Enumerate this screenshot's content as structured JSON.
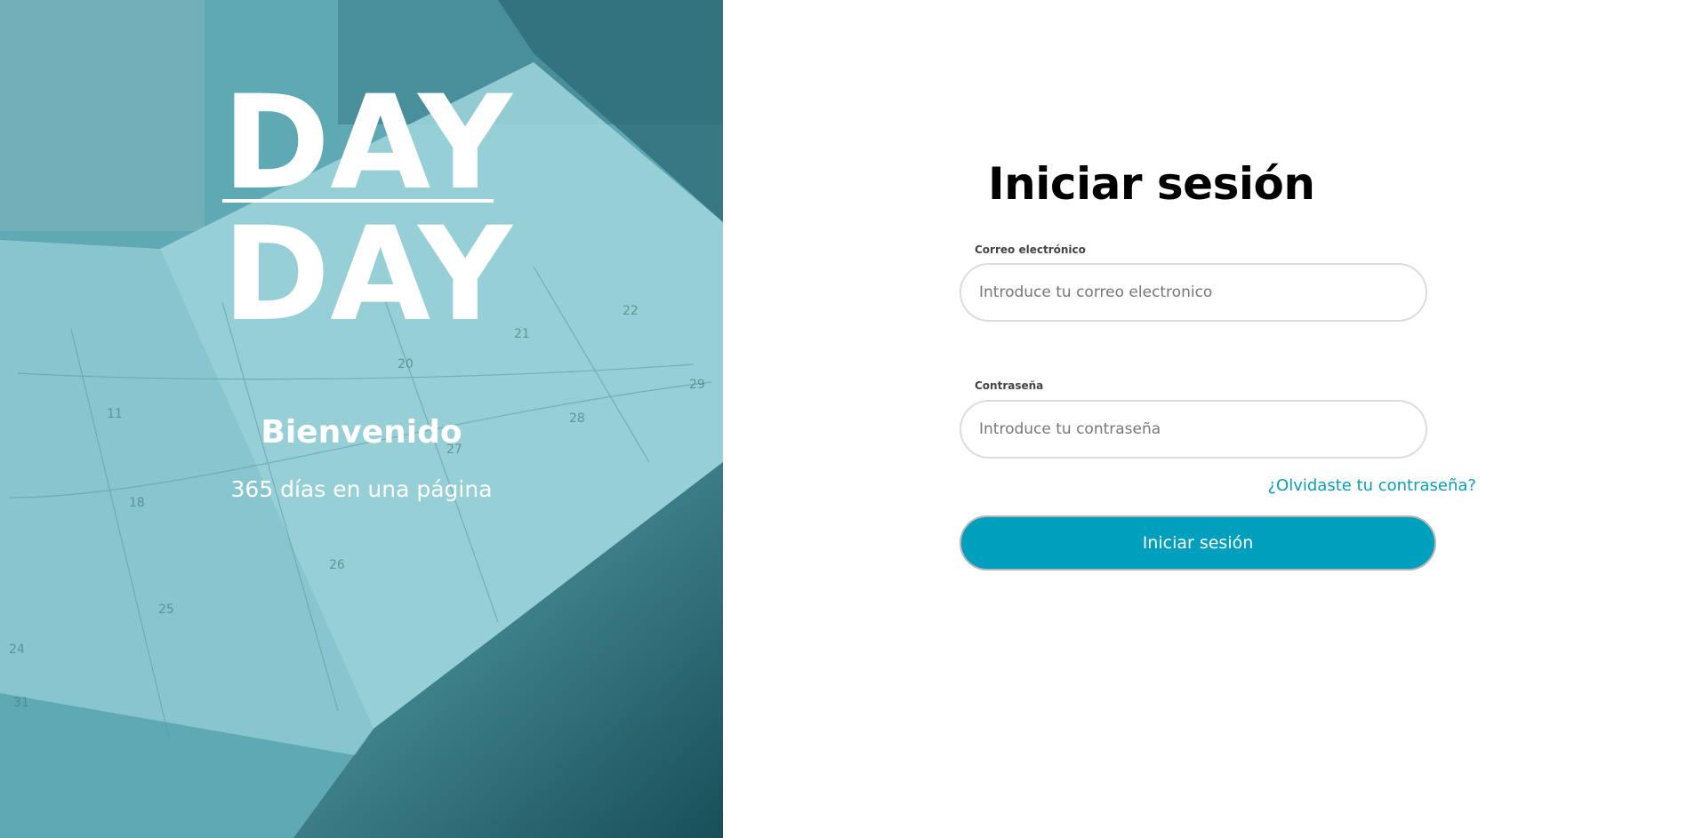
{
  "brand": {
    "logo_top": "DAY",
    "logo_bottom": "DAY",
    "welcome_title": "Bienvenido",
    "welcome_subtitle": "365 días en una página"
  },
  "login": {
    "title": "Iniciar sesión",
    "email": {
      "label": "Correo electrónico",
      "placeholder": "Introduce tu correo electronico",
      "value": ""
    },
    "password": {
      "label": "Contraseña",
      "placeholder": "Introduce tu contraseña",
      "value": ""
    },
    "forgot_password_link": "¿Olvidaste tu contraseña?",
    "submit_label": "Iniciar sesión"
  },
  "colors": {
    "accent": "#009fbd",
    "link": "#0a9db8",
    "hero_tint": "#5aa9b5"
  }
}
